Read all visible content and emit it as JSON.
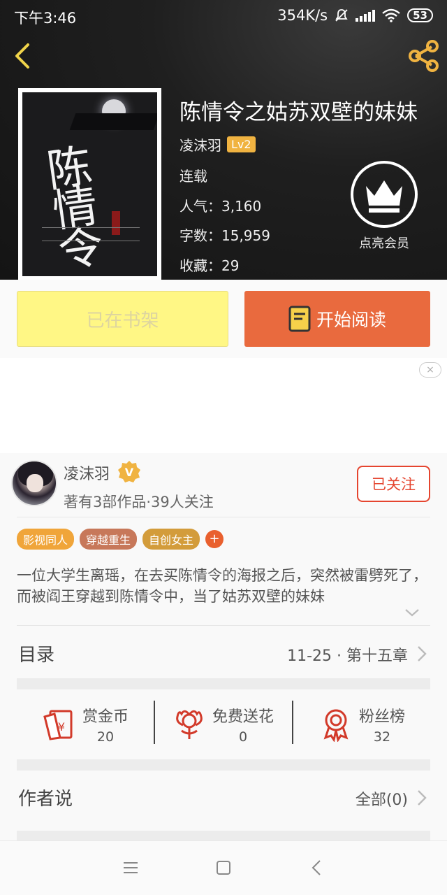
{
  "status_bar": {
    "time": "下午3:46",
    "network_speed": "354K/s",
    "battery": "53"
  },
  "book": {
    "title": "陈情令之姑苏双壁的妹妹",
    "author": "凌沫羽",
    "author_level": "Lv2",
    "status": "连载",
    "popularity": "人气：3,160",
    "word_count": "字数：15,959",
    "favorites": "收藏：29",
    "cover_art_text": "陈情令"
  },
  "vip": {
    "label": "点亮会员"
  },
  "actions": {
    "shelf_label": "已在书架",
    "read_label": "开始阅读"
  },
  "ad": {
    "close_label": "×"
  },
  "author_card": {
    "name": "凌沫羽",
    "verified_badge": "V",
    "summary": "著有3部作品·39人关注",
    "follow_label": "已关注"
  },
  "tags": [
    {
      "label": "影视同人",
      "color": "#f0a53a"
    },
    {
      "label": "穿越重生",
      "color": "#c7785a"
    },
    {
      "label": "自创女主",
      "color": "#d39c3b"
    }
  ],
  "tag_add": "+",
  "description": "一位大学生离瑶，在去买陈情令的海报之后，突然被雷劈死了，而被阎王穿越到陈情令中，当了姑苏双壁的妹妹",
  "toc": {
    "label": "目录",
    "latest": "11-25 · 第十五章"
  },
  "stats": [
    {
      "label": "赏金币",
      "value": "20",
      "icon": "red-envelope-icon"
    },
    {
      "label": "免费送花",
      "value": "0",
      "icon": "flower-icon"
    },
    {
      "label": "粉丝榜",
      "value": "32",
      "icon": "medal-icon"
    }
  ],
  "author_says": {
    "label": "作者说",
    "all": "全部(0)"
  },
  "colors": {
    "accent": "#e96a3e",
    "shelf": "#fff785",
    "follow": "#e5452f",
    "icon_red": "#d23a2a"
  }
}
